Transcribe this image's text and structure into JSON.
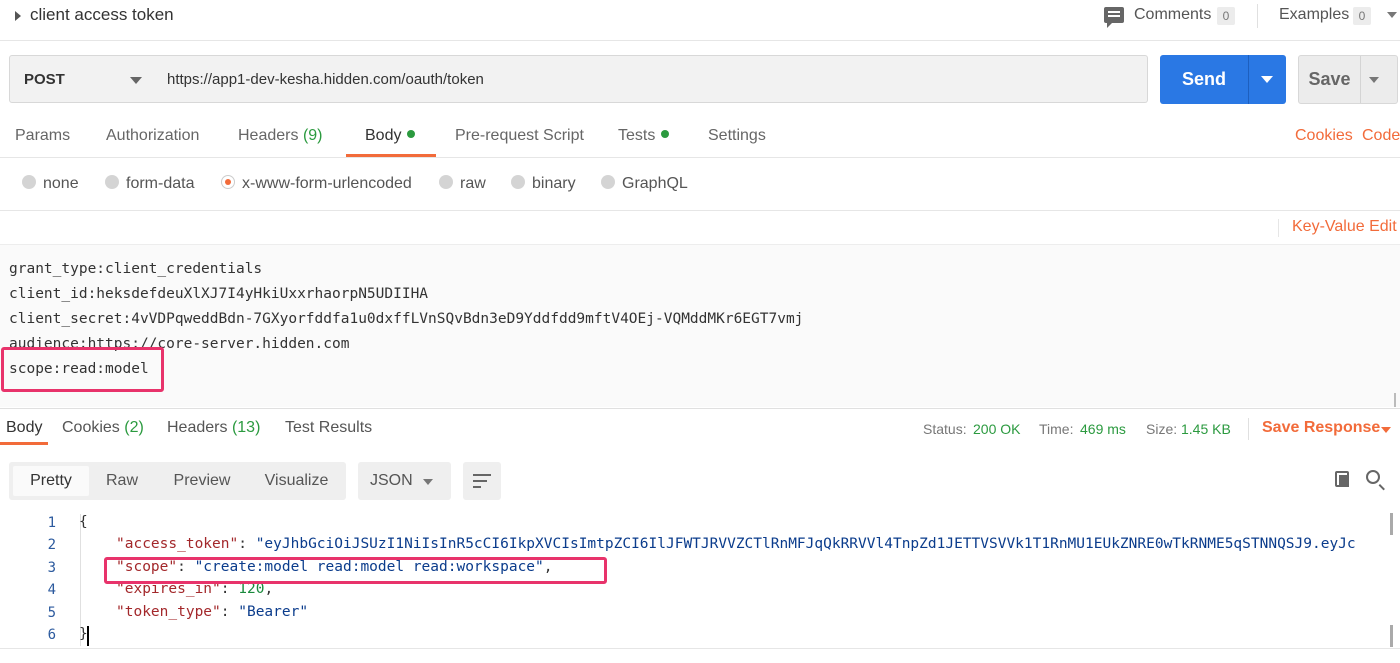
{
  "request": {
    "name": "client access token",
    "comments_label": "Comments",
    "comments_count": "0",
    "examples_label": "Examples",
    "examples_count": "0",
    "method": "POST",
    "url": "https://app1-dev-kesha.hidden.com/oauth/token",
    "send_label": "Send",
    "save_label": "Save"
  },
  "request_tabs": {
    "params": "Params",
    "authorization": "Authorization",
    "headers": "Headers",
    "headers_count": "(9)",
    "body": "Body",
    "prerequest": "Pre-request Script",
    "tests": "Tests",
    "settings": "Settings",
    "cookies": "Cookies",
    "code": "Code"
  },
  "body_types": {
    "none": "none",
    "form_data": "form-data",
    "urlencoded": "x-www-form-urlencoded",
    "raw": "raw",
    "binary": "binary",
    "graphql": "GraphQL",
    "selected": "x-www-form-urlencoded"
  },
  "bulk_edit": {
    "toggle_label": "Key-Value Edit",
    "lines": [
      "grant_type:client_credentials",
      "client_id:heksdefdeuXlXJ7I4yHkiUxxrhaorpN5UDIIHA",
      "client_secret:4vVDPqweddBdn-7GXyorfddfa1u0dxffLVnSQvBdn3eD9Yddfdd9mftV4OEj-VQMddMKr6EGT7vmj",
      "audience:https://core-server.hidden.com",
      "scope:read:model"
    ]
  },
  "response_tabs": {
    "body": "Body",
    "cookies": "Cookies",
    "cookies_count": "(2)",
    "headers": "Headers",
    "headers_count": "(13)",
    "test_results": "Test Results"
  },
  "response_status": {
    "status_label": "Status:",
    "status_value": "200 OK",
    "time_label": "Time:",
    "time_value": "469 ms",
    "size_label": "Size:",
    "size_value": "1.45 KB",
    "save_response": "Save Response"
  },
  "response_view": {
    "modes": [
      "Pretty",
      "Raw",
      "Preview",
      "Visualize"
    ],
    "selected_mode": "Pretty",
    "format": "JSON"
  },
  "response_body": {
    "line_numbers": [
      "1",
      "2",
      "3",
      "4",
      "5",
      "6"
    ],
    "open_brace": "{",
    "close_brace": "}",
    "access_token_key": "\"access_token\"",
    "access_token_value": "\"eyJhbGciOiJSUzI1NiIsInR5cCI6IkpXVCIsImtpZCI6IlJFWTJRVVZCTlRnMFJqQkRRVVl4TnpZd1JETTVSVVk1T1RnMU1EUkZNRE0wTkRNME5qSTNNQSJ9.eyJc",
    "scope_key": "\"scope\"",
    "scope_value": "\"create:model read:model read:workspace\"",
    "expires_in_key": "\"expires_in\"",
    "expires_in_value": "120",
    "token_type_key": "\"token_type\"",
    "token_type_value": "\"Bearer\""
  },
  "colors": {
    "accent": "#f26b3a",
    "send_blue": "#2a78e4",
    "success_green": "#2b9a3f",
    "highlight_pink": "#e8336b"
  },
  "icons": [
    "caret-right-icon",
    "comment-icon",
    "chevron-down-icon",
    "wrap-lines-icon",
    "copy-icon",
    "search-icon"
  ]
}
